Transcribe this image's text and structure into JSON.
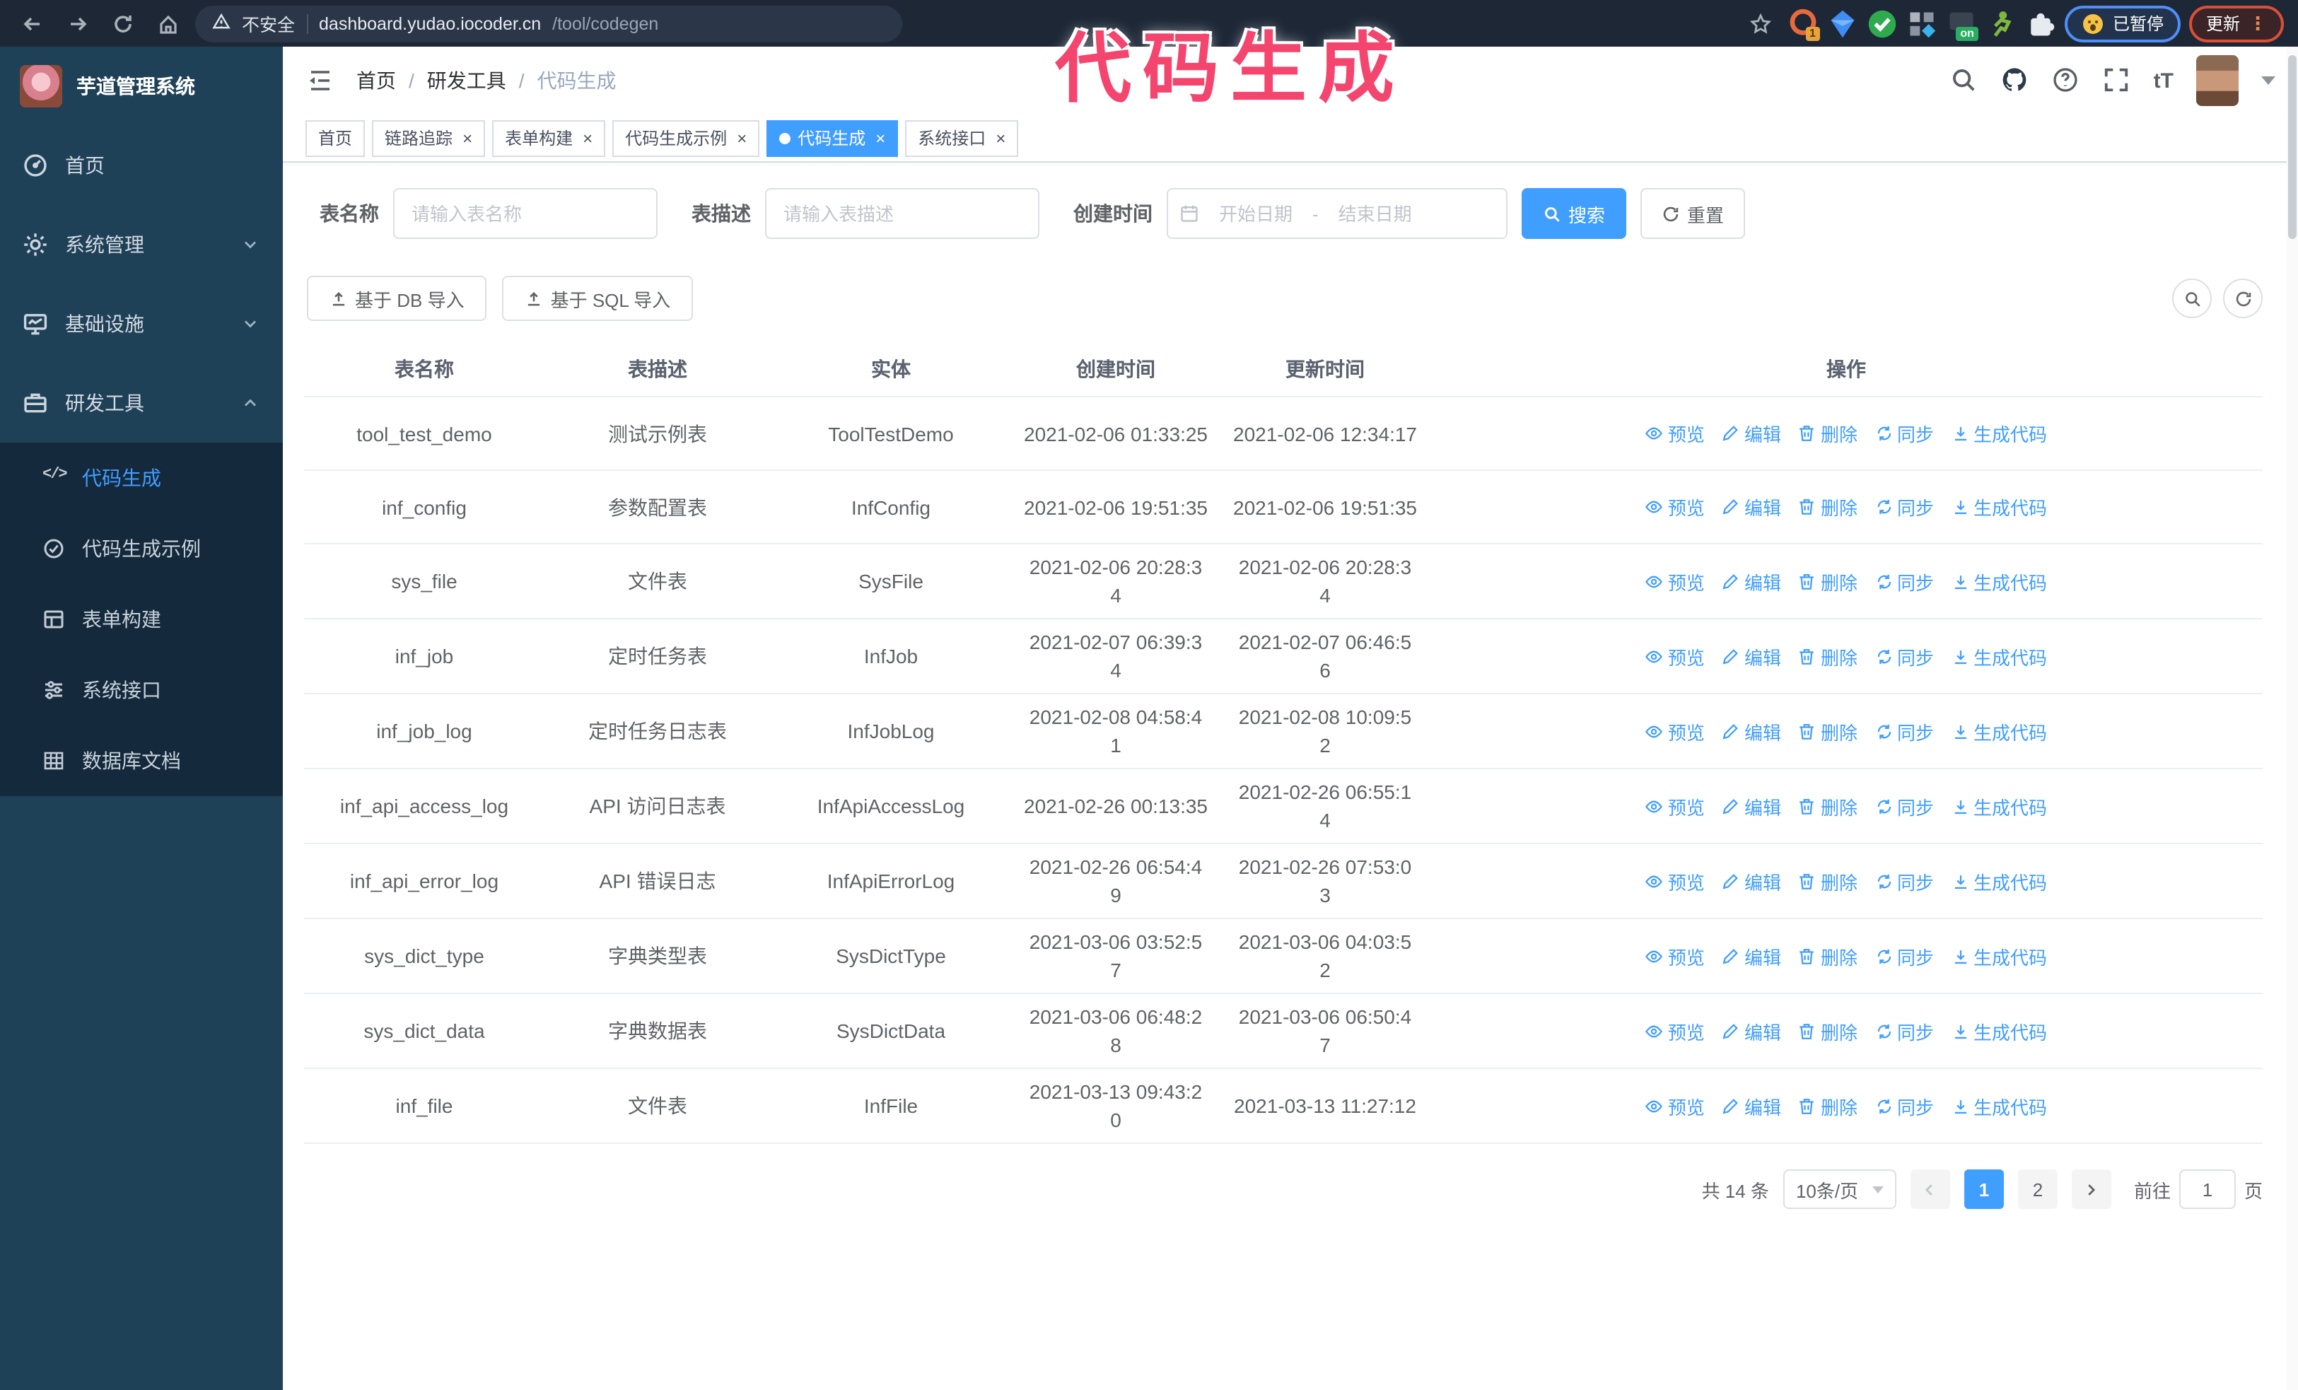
{
  "caption": "代码生成",
  "colors": {
    "accent": "#409EFF",
    "caption_pink": "#F4456E",
    "sidebar_bg": "#1F4158",
    "submenu_bg": "#15293D",
    "browser_bar": "#1D2736"
  },
  "icons": {
    "question_glyph": "?",
    "fontsize_glyph": "tT",
    "code_glyph": "</>",
    "close_glyph": "×",
    "ellipsis_glyph": "⋮"
  },
  "browser": {
    "security_label": "不安全",
    "url_host": "dashboard.yudao.iocoder.cn",
    "url_path": "/tool/codegen",
    "ext_badge_count": "1",
    "ext_badge_on": "on",
    "paused_label": "已暂停",
    "update_label": "更新"
  },
  "sidebar": {
    "title": "芋道管理系统",
    "items": [
      {
        "label": "首页"
      },
      {
        "label": "系统管理"
      },
      {
        "label": "基础设施"
      },
      {
        "label": "研发工具"
      }
    ],
    "subitems": [
      {
        "label": "代码生成"
      },
      {
        "label": "代码生成示例"
      },
      {
        "label": "表单构建"
      },
      {
        "label": "系统接口"
      },
      {
        "label": "数据库文档"
      }
    ]
  },
  "navbar": {
    "breadcrumb": [
      "首页",
      "研发工具",
      "代码生成"
    ],
    "breadcrumb_sep": "/"
  },
  "tabs": [
    {
      "label": "首页"
    },
    {
      "label": "链路追踪"
    },
    {
      "label": "表单构建"
    },
    {
      "label": "代码生成示例"
    },
    {
      "label": "代码生成"
    },
    {
      "label": "系统接口"
    }
  ],
  "filters": {
    "name_label": "表名称",
    "name_placeholder": "请输入表名称",
    "desc_label": "表描述",
    "desc_placeholder": "请输入表描述",
    "time_label": "创建时间",
    "start_placeholder": "开始日期",
    "range_sep": "-",
    "end_placeholder": "结束日期",
    "search_label": "搜索",
    "reset_label": "重置"
  },
  "toolbar": {
    "db_import_label": "基于 DB 导入",
    "sql_import_label": "基于 SQL 导入"
  },
  "table": {
    "columns": [
      "表名称",
      "表描述",
      "实体",
      "创建时间",
      "更新时间",
      "操作"
    ],
    "actions": [
      "预览",
      "编辑",
      "删除",
      "同步",
      "生成代码"
    ],
    "rows": [
      {
        "name": "tool_test_demo",
        "desc": "测试示例表",
        "entity": "ToolTestDemo",
        "created": "2021-02-06 01:33:25",
        "updated": "2021-02-06 12:34:17"
      },
      {
        "name": "inf_config",
        "desc": "参数配置表",
        "entity": "InfConfig",
        "created": "2021-02-06 19:51:35",
        "updated": "2021-02-06 19:51:35"
      },
      {
        "name": "sys_file",
        "desc": "文件表",
        "entity": "SysFile",
        "created": "2021-02-06 20:28:3\n4",
        "updated": "2021-02-06 20:28:3\n4"
      },
      {
        "name": "inf_job",
        "desc": "定时任务表",
        "entity": "InfJob",
        "created": "2021-02-07 06:39:3\n4",
        "updated": "2021-02-07 06:46:5\n6"
      },
      {
        "name": "inf_job_log",
        "desc": "定时任务日志表",
        "entity": "InfJobLog",
        "created": "2021-02-08 04:58:4\n1",
        "updated": "2021-02-08 10:09:5\n2"
      },
      {
        "name": "inf_api_access_log",
        "desc": "API 访问日志表",
        "entity": "InfApiAccessLog",
        "created": "2021-02-26 00:13:35",
        "updated": "2021-02-26 06:55:1\n4"
      },
      {
        "name": "inf_api_error_log",
        "desc": "API 错误日志",
        "entity": "InfApiErrorLog",
        "created": "2021-02-26 06:54:4\n9",
        "updated": "2021-02-26 07:53:0\n3"
      },
      {
        "name": "sys_dict_type",
        "desc": "字典类型表",
        "entity": "SysDictType",
        "created": "2021-03-06 03:52:5\n7",
        "updated": "2021-03-06 04:03:5\n2"
      },
      {
        "name": "sys_dict_data",
        "desc": "字典数据表",
        "entity": "SysDictData",
        "created": "2021-03-06 06:48:2\n8",
        "updated": "2021-03-06 06:50:4\n7"
      },
      {
        "name": "inf_file",
        "desc": "文件表",
        "entity": "InfFile",
        "created": "2021-03-13 09:43:2\n0",
        "updated": "2021-03-13 11:27:12"
      }
    ]
  },
  "pagination": {
    "total_label": "共 14 条",
    "page_size_label": "10条/页",
    "pages": [
      "1",
      "2"
    ],
    "goto_label": "前往",
    "goto_value": "1",
    "page_unit_label": "页"
  }
}
